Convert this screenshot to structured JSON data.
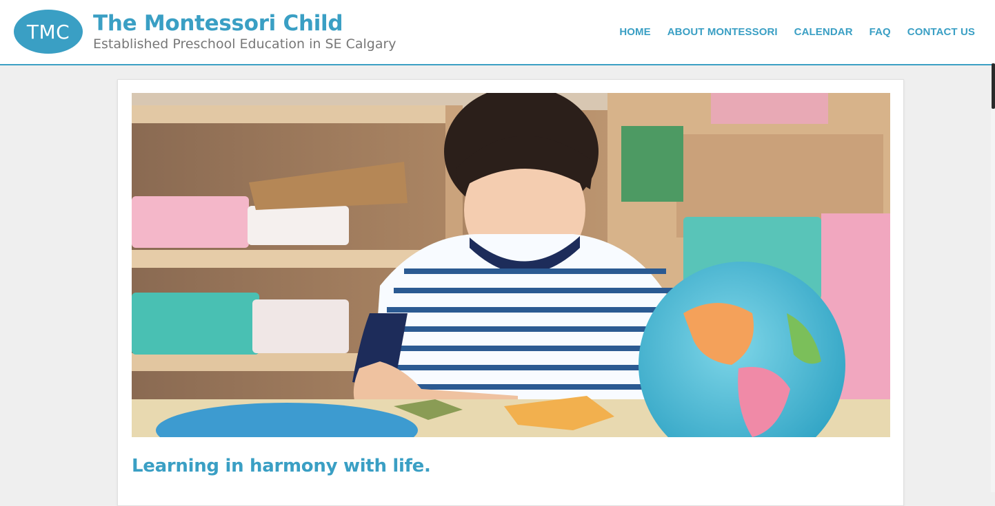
{
  "site": {
    "logo_text": "TMC",
    "title": "The Montessori Child",
    "tagline": "Established Preschool Education in SE Calgary"
  },
  "nav": {
    "items": [
      {
        "label": "HOME"
      },
      {
        "label": "ABOUT MONTESSORI"
      },
      {
        "label": "CALENDAR"
      },
      {
        "label": "FAQ"
      },
      {
        "label": "CONTACT US"
      }
    ]
  },
  "main": {
    "hero_image": "child-with-globe-puzzle-photo",
    "headline": "Learning in harmony with life."
  },
  "colors": {
    "brand": "#3a9fc4",
    "background": "#efefef",
    "tagline": "#777777"
  }
}
